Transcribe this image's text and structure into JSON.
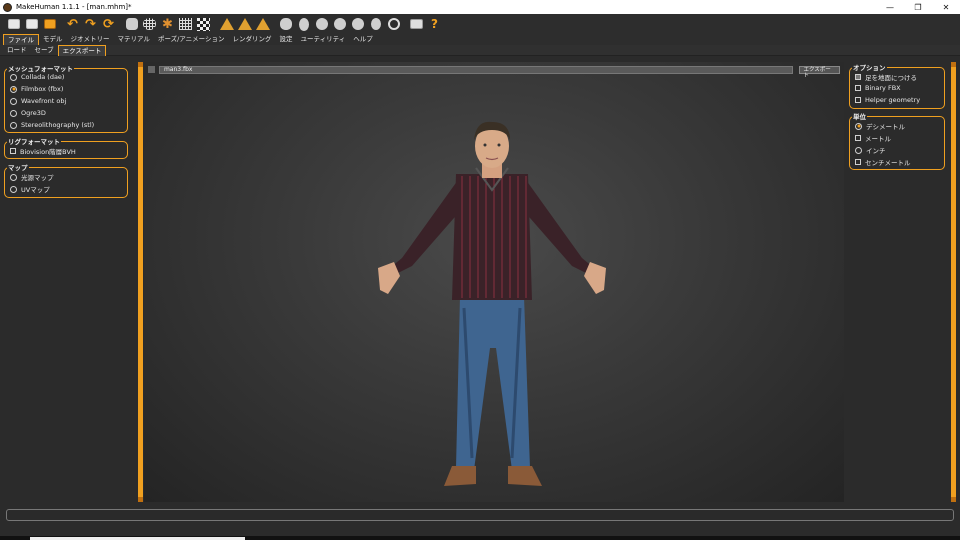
{
  "window": {
    "title": "MakeHuman 1.1.1 - [man.mhm]*",
    "minimize": "—",
    "restore": "❐",
    "close": "✕"
  },
  "toolbar": {
    "icons": [
      "new-file-icon",
      "save-icon",
      "export-icon",
      "undo-icon",
      "redo-icon",
      "reset-icon",
      "smooth-icon",
      "wireframe-icon",
      "pose-icon",
      "grid-icon",
      "checker-icon",
      "front-view-icon",
      "side-view-icon",
      "back-view-icon",
      "face-view-icon",
      "head-icon",
      "left-view-icon",
      "right-view-icon",
      "top-view-icon",
      "bottom-view-icon",
      "frame-icon",
      "screenshot-icon",
      "help-icon"
    ],
    "help_label": "?"
  },
  "tabs": {
    "main": [
      "ファイル",
      "モデル",
      "ジオメトリー",
      "マテリアル",
      "ポーズ/アニメーション",
      "レンダリング",
      "設定",
      "ユーティリティ",
      "ヘルプ"
    ],
    "sub": [
      "ロード",
      "セーブ",
      "エクスポート"
    ]
  },
  "left": {
    "mesh_format": {
      "title": "メッシュフォーマット",
      "options": [
        "Collada (dae)",
        "Filmbox (fbx)",
        "Wavefront obj",
        "Ogre3D",
        "Stereolithography (stl)"
      ],
      "selected": "Filmbox (fbx)"
    },
    "rig_format": {
      "title": "リグフォーマット",
      "options": [
        "Biovision階層BVH"
      ]
    },
    "maps": {
      "title": "マップ",
      "options": [
        "光源マップ",
        "UVマップ"
      ]
    }
  },
  "right": {
    "options": {
      "title": "オプション",
      "items": [
        {
          "label": "足を地面につける",
          "checked": true
        },
        {
          "label": "Binary FBX",
          "checked": false
        },
        {
          "label": "Helper geometry",
          "checked": false
        }
      ]
    },
    "units": {
      "title": "単位",
      "options": [
        "デシメートル",
        "メートル",
        "インチ",
        "センチメートル"
      ],
      "selected": "デシメートル"
    }
  },
  "export_bar": {
    "filename": "man3.fbx",
    "button": "エクスポート"
  },
  "colors": {
    "accent": "#f0a020",
    "background": "#2b2b2b"
  }
}
